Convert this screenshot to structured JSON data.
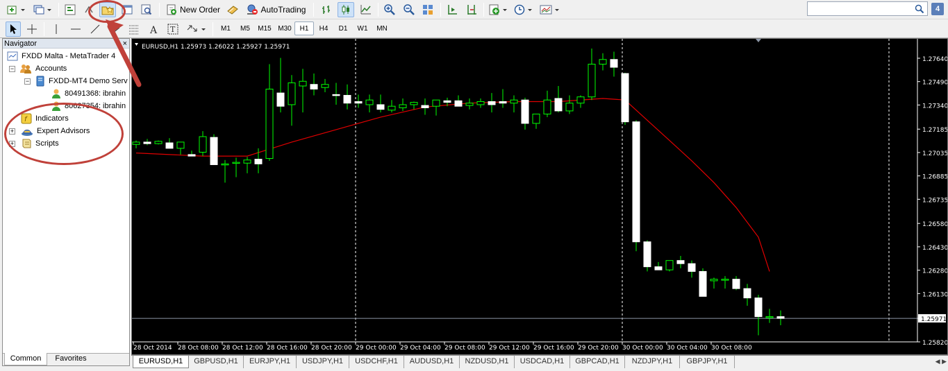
{
  "toolbar": {
    "new_order_label": "New Order",
    "autotrading_label": "AutoTrading",
    "search_placeholder": "",
    "help_badge": "4",
    "timeframes": [
      "M1",
      "M5",
      "M15",
      "M30",
      "H1",
      "H4",
      "D1",
      "W1",
      "MN"
    ],
    "active_timeframe": "H1"
  },
  "navigator": {
    "title": "Navigator",
    "close": "×",
    "root": "FXDD Malta - MetaTrader 4",
    "accounts": "Accounts",
    "server": "FXDD-MT4 Demo Serv",
    "account_1": "80491368: ibrahin",
    "account_2": "80627354: ibrahin",
    "indicators": "Indicators",
    "experts": "Expert Advisors",
    "scripts": "Scripts",
    "tab_common": "Common",
    "tab_favorites": "Favorites"
  },
  "chart": {
    "header": "EURUSD,H1  1.25973 1.26022 1.25927 1.25971",
    "current_price": "1.25971",
    "colors": {
      "background": "#000000",
      "bull": "#ffffff",
      "wick": "#00ff00",
      "ma": "#e00000",
      "grid": "#ffffff"
    }
  },
  "chart_data": {
    "type": "candlestick",
    "symbol": "EURUSD",
    "timeframe": "H1",
    "y_ticks": [
      "1.27640",
      "1.27490",
      "1.27340",
      "1.27185",
      "1.27035",
      "1.26885",
      "1.26735",
      "1.26580",
      "1.26430",
      "1.26280",
      "1.26130",
      "1.25971",
      "1.25820"
    ],
    "y_tick_values": [
      1.2764,
      1.2749,
      1.2734,
      1.27185,
      1.27035,
      1.26885,
      1.26735,
      1.2658,
      1.2643,
      1.2628,
      1.2613,
      1.25971,
      1.2582
    ],
    "ylim": [
      1.2582,
      1.2772
    ],
    "x_ticks": [
      "28 Oct 2014",
      "28 Oct 08:00",
      "28 Oct 12:00",
      "28 Oct 16:00",
      "28 Oct 20:00",
      "29 Oct 00:00",
      "29 Oct 04:00",
      "29 Oct 08:00",
      "29 Oct 12:00",
      "29 Oct 16:00",
      "29 Oct 20:00",
      "30 Oct 00:00",
      "30 Oct 04:00",
      "30 Oct 08:00"
    ],
    "candles": [
      [
        1.27087,
        1.27112,
        1.27062,
        1.27102
      ],
      [
        1.27102,
        1.27122,
        1.27082,
        1.27092
      ],
      [
        1.27092,
        1.27112,
        1.27087,
        1.27107
      ],
      [
        1.27097,
        1.27127,
        1.27077,
        1.27062
      ],
      [
        1.27062,
        1.27077,
        1.27022,
        1.27102
      ],
      [
        1.27022,
        1.27047,
        1.27012,
        1.27012
      ],
      [
        1.27037,
        1.27172,
        1.27012,
        1.27137
      ],
      [
        1.27132,
        1.27152,
        1.26957,
        1.26957
      ],
      [
        1.26962,
        1.26987,
        1.26842,
        1.26962
      ],
      [
        1.26967,
        1.27002,
        1.26877,
        1.26972
      ],
      [
        1.26967,
        1.27007,
        1.26902,
        1.26987
      ],
      [
        1.26992,
        1.27062,
        1.26902,
        1.26962
      ],
      [
        1.26997,
        1.27602,
        1.26982,
        1.27442
      ],
      [
        1.27417,
        1.27642,
        1.27292,
        1.27332
      ],
      [
        1.27342,
        1.27532,
        1.27207,
        1.27482
      ],
      [
        1.27462,
        1.27572,
        1.27292,
        1.27492
      ],
      [
        1.27472,
        1.27542,
        1.27402,
        1.27442
      ],
      [
        1.27452,
        1.27507,
        1.27422,
        1.27472
      ],
      [
        1.27407,
        1.27482,
        1.27342,
        1.27402
      ],
      [
        1.27402,
        1.27472,
        1.27312,
        1.27352
      ],
      [
        1.27362,
        1.27407,
        1.27322,
        1.27352
      ],
      [
        1.27342,
        1.27407,
        1.27292,
        1.27372
      ],
      [
        1.27342,
        1.27407,
        1.27292,
        1.27312
      ],
      [
        1.27307,
        1.27372,
        1.27292,
        1.27332
      ],
      [
        1.27322,
        1.27382,
        1.27302,
        1.27342
      ],
      [
        1.27342,
        1.27362,
        1.27312,
        1.27357
      ],
      [
        1.27337,
        1.27382,
        1.27277,
        1.27322
      ],
      [
        1.27332,
        1.27362,
        1.27272,
        1.27372
      ],
      [
        1.27367,
        1.27387,
        1.27332,
        1.27357
      ],
      [
        1.27367,
        1.27402,
        1.27332,
        1.27332
      ],
      [
        1.27337,
        1.27382,
        1.27312,
        1.27352
      ],
      [
        1.27342,
        1.27382,
        1.27322,
        1.27362
      ],
      [
        1.27362,
        1.27417,
        1.27292,
        1.27342
      ],
      [
        1.27362,
        1.27442,
        1.27322,
        1.27352
      ],
      [
        1.27352,
        1.27402,
        1.27292,
        1.27372
      ],
      [
        1.27372,
        1.27387,
        1.27182,
        1.27222
      ],
      [
        1.27222,
        1.27277,
        1.27187,
        1.27282
      ],
      [
        1.27282,
        1.27432,
        1.27262,
        1.27372
      ],
      [
        1.27382,
        1.27462,
        1.27292,
        1.27302
      ],
      [
        1.27302,
        1.27402,
        1.27282,
        1.27352
      ],
      [
        1.27352,
        1.27402,
        1.27322,
        1.27392
      ],
      [
        1.27392,
        1.27702,
        1.27372,
        1.27602
      ],
      [
        1.27602,
        1.27672,
        1.27562,
        1.27632
      ],
      [
        1.27632,
        1.27682,
        1.27522,
        1.27582
      ],
      [
        1.27542,
        1.27547,
        1.27212,
        1.27232
      ],
      [
        1.27232,
        1.27242,
        1.26402,
        1.26462
      ],
      [
        1.26462,
        1.26472,
        1.26272,
        1.26302
      ],
      [
        1.26302,
        1.26332,
        1.26282,
        1.26282
      ],
      [
        1.26282,
        1.26342,
        1.26272,
        1.26342
      ],
      [
        1.26342,
        1.26372,
        1.26292,
        1.26322
      ],
      [
        1.26322,
        1.26342,
        1.26232,
        1.26272
      ],
      [
        1.26272,
        1.26292,
        1.26162,
        1.26112
      ],
      [
        1.26212,
        1.26232,
        1.26162,
        1.26222
      ],
      [
        1.26222,
        1.26242,
        1.26162,
        1.26222
      ],
      [
        1.26222,
        1.26242,
        1.26152,
        1.26162
      ],
      [
        1.26162,
        1.26192,
        1.26052,
        1.26102
      ],
      [
        1.26102,
        1.26122,
        1.25862,
        1.25982
      ],
      [
        1.25982,
        1.26032,
        1.25942,
        1.25982
      ],
      [
        1.25982,
        1.26022,
        1.25927,
        1.25971
      ]
    ],
    "moving_average": [
      [
        0,
        1.27032
      ],
      [
        6,
        1.27012
      ],
      [
        10,
        1.27012
      ],
      [
        14,
        1.27102
      ],
      [
        18,
        1.27182
      ],
      [
        22,
        1.27262
      ],
      [
        26,
        1.27327
      ],
      [
        30,
        1.27352
      ],
      [
        34,
        1.27362
      ],
      [
        38,
        1.27362
      ],
      [
        42,
        1.27382
      ],
      [
        44,
        1.27372
      ],
      [
        46,
        1.27242
      ],
      [
        48,
        1.27112
      ],
      [
        50,
        1.26982
      ],
      [
        52,
        1.26842
      ],
      [
        54,
        1.26682
      ],
      [
        56,
        1.26492
      ],
      [
        57,
        1.26272
      ]
    ]
  },
  "symbol_tabs": [
    "EURUSD,H1",
    "GBPUSD,H1",
    "EURJPY,H1",
    "USDJPY,H1",
    "USDCHF,H1",
    "AUDUSD,H1",
    "NZDUSD,H1",
    "USDCAD,H1",
    "GBPCAD,H1",
    "NZDJPY,H1",
    "GBPJPY,H1"
  ],
  "active_symbol_tab": "EURUSD,H1"
}
